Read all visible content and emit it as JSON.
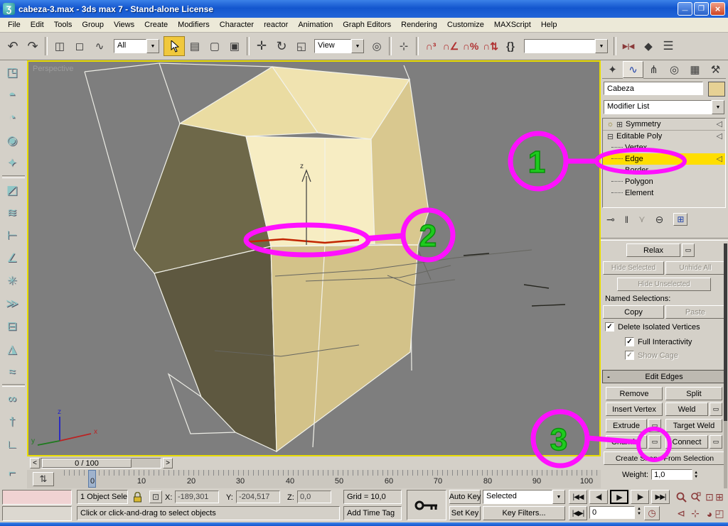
{
  "window": {
    "title": "cabeza-3.max - 3ds max 7  - Stand-alone License",
    "app_icon_glyph": "Ʒ",
    "minimize": "—",
    "maximize": "❐",
    "close": "×"
  },
  "menu": {
    "items": [
      "File",
      "Edit",
      "Tools",
      "Group",
      "Views",
      "Create",
      "Modifiers",
      "Character",
      "reactor",
      "Animation",
      "Graph Editors",
      "Rendering",
      "Customize",
      "MAXScript",
      "Help"
    ]
  },
  "toolbar": {
    "selection_filter": "All",
    "reference_coordsys": "View",
    "named_selection": "",
    "icons": {
      "undo": "↶",
      "redo": "↷",
      "select_link": "◫",
      "unlink": "◻",
      "bind_spacewarp": "∿",
      "select_by_name": "▤",
      "rect_region": "▢",
      "window_crossing": "▣",
      "move": "✛",
      "rotate": "↻",
      "scale": "◱",
      "use_center": "◎",
      "manipulate": "⊹",
      "snap_3": "∩³",
      "snap_angle": "∩∠",
      "snap_percent": "∩%",
      "snap_spinner": "∩⇅",
      "named_sets": "{}",
      "mirror": "▶|◀",
      "align": "◆",
      "layers": "☰",
      "combo_arrow": "▼"
    }
  },
  "left_toolbar": {
    "items": [
      {
        "name": "rigid-body-collection",
        "glyph": "◳"
      },
      {
        "name": "cloth-collection",
        "glyph": "◓"
      },
      {
        "name": "soft-body-collection",
        "glyph": "◔"
      },
      {
        "name": "rope-collection",
        "glyph": "◉"
      },
      {
        "name": "deforming-mesh-collection",
        "glyph": "✦"
      },
      {
        "name": "plane",
        "glyph": "◩"
      },
      {
        "name": "spring",
        "glyph": "≋"
      },
      {
        "name": "linear-dashpot",
        "glyph": "⊢"
      },
      {
        "name": "angular-dashpot",
        "glyph": "∠"
      },
      {
        "name": "motor",
        "glyph": "✳"
      },
      {
        "name": "wind",
        "glyph": "≫"
      },
      {
        "name": "toy-car",
        "glyph": "⊟"
      },
      {
        "name": "fracture",
        "glyph": "◮"
      },
      {
        "name": "water",
        "glyph": "≈"
      },
      {
        "name": "constraint-solver",
        "glyph": "∞"
      },
      {
        "name": "ragdoll-constraint",
        "glyph": "†"
      },
      {
        "name": "hinge-constraint",
        "glyph": "∟"
      },
      {
        "name": "point-point-constraint",
        "glyph": "⌐"
      },
      {
        "name": "prismatic-constraint",
        "glyph": "⊓"
      }
    ]
  },
  "viewport": {
    "label": "Perspective",
    "gizmo_z_label": "z",
    "axis": {
      "x": "x",
      "y": "y",
      "z": "z"
    }
  },
  "command_panel": {
    "tabs": [
      {
        "name": "create",
        "glyph": "✦"
      },
      {
        "name": "modify",
        "glyph": "∿"
      },
      {
        "name": "hierarchy",
        "glyph": "⋔"
      },
      {
        "name": "motion",
        "glyph": "◎"
      },
      {
        "name": "display",
        "glyph": "▦"
      },
      {
        "name": "utilities",
        "glyph": "⚒"
      }
    ],
    "object_name": "Cabeza",
    "modifier_list_label": "Modifier List",
    "stack": [
      {
        "label": "Symmetry"
      },
      {
        "label": "Editable Poly"
      },
      {
        "label": "Vertex"
      },
      {
        "label": "Edge"
      },
      {
        "label": "Border"
      },
      {
        "label": "Polygon"
      },
      {
        "label": "Element"
      }
    ],
    "stack_icons": {
      "bulb": "☼",
      "expand": "⊞",
      "collapse": "⊟",
      "row_arrow": "◁"
    },
    "stack_toolbar": {
      "pin": "⊸",
      "show_end_result": "‖",
      "make_unique": "⋎",
      "remove_modifier": "⊖",
      "configure": "⊞"
    },
    "params": {
      "relax": "Relax",
      "hide_selected": "Hide Selected",
      "unhide_all": "Unhide All",
      "hide_unselected": "Hide Unselected",
      "named_selections": "Named Selections:",
      "copy": "Copy",
      "paste": "Paste",
      "delete_isolated": "Delete Isolated Vertices",
      "full_interactivity": "Full Interactivity",
      "show_cage": "Show Cage",
      "check": "✓"
    },
    "edit_edges": {
      "collapse_glyph": "-",
      "title": "Edit Edges",
      "remove": "Remove",
      "split": "Split",
      "insert_vertex": "Insert Vertex",
      "weld": "Weld",
      "extrude": "Extrude",
      "target_weld": "Target Weld",
      "chamfer": "Chamfer",
      "connect": "Connect",
      "create_shape": "Create Shape From Selection",
      "settings_glyph": "▭",
      "weight_label": "Weight:",
      "weight_value": "1,0"
    }
  },
  "timeline": {
    "prev": "<",
    "next": ">",
    "slider_label": "0 / 100",
    "curve_editor_glyph": "⇅",
    "ticks": [
      "0",
      "10",
      "20",
      "30",
      "40",
      "50",
      "60",
      "70",
      "80",
      "90",
      "100"
    ]
  },
  "status_bar": {
    "selection_label": "1 Object Sele",
    "abs_glyph": "⊡",
    "x_label": "X:",
    "x_value": "-189,301",
    "y_label": "Y:",
    "y_value": "-204,517",
    "z_label": "Z:",
    "z_value": "0,0",
    "grid": "Grid = 10,0",
    "prompt": "Click or click-and-drag to select objects",
    "add_time_tag": "Add Time Tag",
    "auto_key": "Auto Key",
    "set_key": "Set Key",
    "anim_mode": "Selected",
    "key_filters": "Key Filters...",
    "frame": "0",
    "icons": {
      "goto_start": "|◀◀",
      "prev_frame": "◀|",
      "play": "▶",
      "next_frame": "|▶",
      "goto_end": "▶▶|",
      "key_mode": "|◀▶|",
      "time_config": "◷",
      "zoom_extents": "⊡",
      "zoom_extents_all": "⊞",
      "fov": "⊲",
      "pan": "⊹",
      "arc_rotate": "◕",
      "minmax": "◰"
    }
  },
  "annotations": {
    "n1": "1",
    "n2": "2",
    "n3": "3"
  },
  "colors": {
    "accent_magenta": "#FF10FF",
    "annotation_green": "#1ECB1E",
    "stack_highlight_yellow": "#FFDE00",
    "selected_edge_red": "#C22500",
    "object_color_swatch": "#E6D194",
    "viewport_gray": "#7E7E7E",
    "active_viewport_border": "#E8DC00"
  }
}
